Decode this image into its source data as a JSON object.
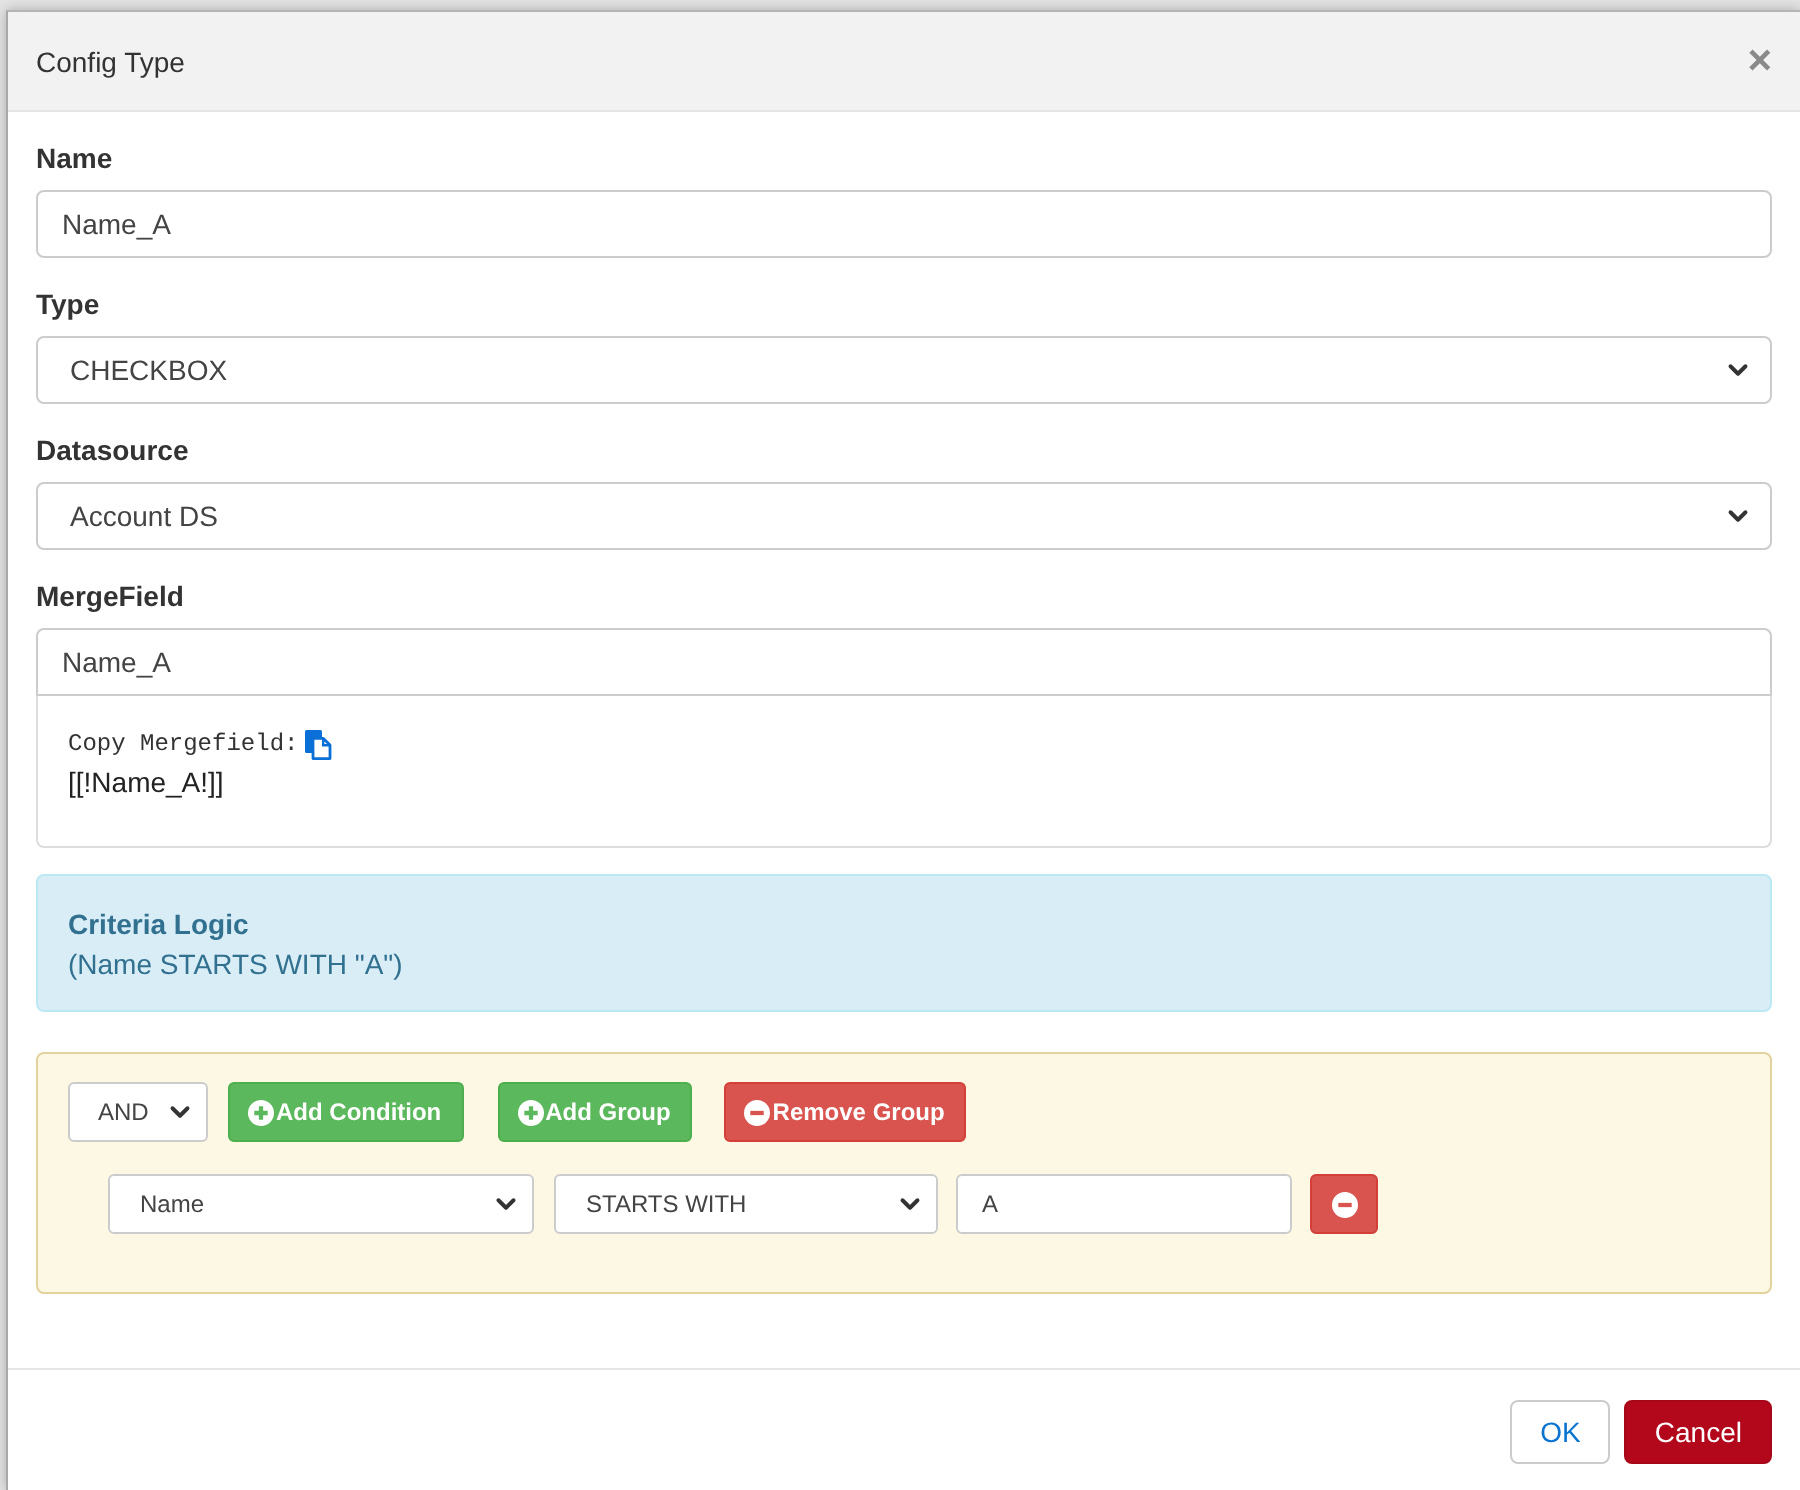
{
  "dialog": {
    "title": "Config Type",
    "close": "×"
  },
  "fields": [
    {
      "kind": "input",
      "label": "Name",
      "value": "Name_A"
    },
    {
      "kind": "select",
      "label": "Type",
      "value": "CHECKBOX"
    },
    {
      "kind": "select",
      "label": "Datasource",
      "value": "Account DS"
    },
    {
      "kind": "input",
      "label": "MergeField",
      "value": "Name_A",
      "copy_label": "Copy Mergefield:",
      "token": "[[!Name_A!]]"
    }
  ],
  "criteria_logic": {
    "title": "Criteria Logic",
    "expression": "(Name STARTS WITH \"A\")"
  },
  "query_group": {
    "conjunction": "AND",
    "buttons": [
      {
        "kind": "add_condition",
        "label": "Add Condition"
      },
      {
        "kind": "add_group",
        "label": "Add Group"
      },
      {
        "kind": "remove_group",
        "label": "Remove Group"
      }
    ],
    "rules": [
      {
        "field": "Name",
        "operator": "STARTS WITH",
        "value": "A"
      }
    ]
  },
  "footer_buttons": [
    {
      "kind": "ok",
      "label": "OK"
    },
    {
      "kind": "cancel",
      "label": "Cancel"
    }
  ]
}
